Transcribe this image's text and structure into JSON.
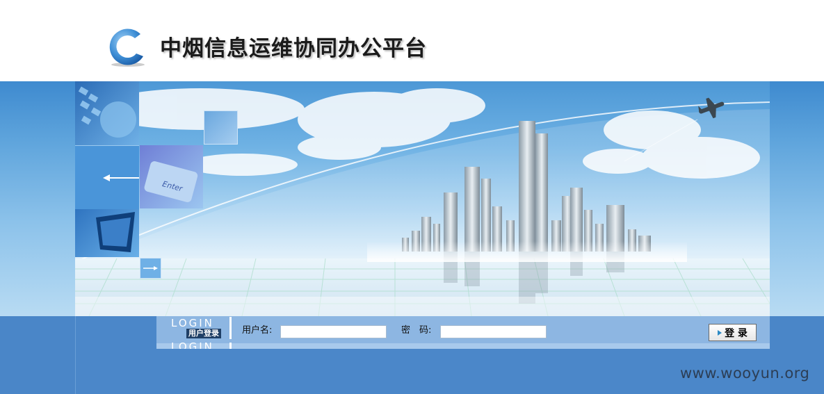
{
  "header": {
    "title": "中烟信息运维协同办公平台"
  },
  "login": {
    "heading": "LOGIN",
    "heading_echo": "LOGIN",
    "subheading": "用户登录",
    "username_label": "用户名:",
    "username_value": "",
    "password_label": "密　码:",
    "password_value": "",
    "submit_label": "登 录"
  },
  "banner": {
    "enter_key_text": "Enter"
  },
  "watermark": "www.wooyun.org",
  "colors": {
    "login_bar": "#4a86c8",
    "login_strip": "#8db6e2",
    "banner_sky_top": "#4d98d6",
    "title_text": "#1b1b1b"
  },
  "icons": [
    "logo-icon",
    "arrow-left-icon",
    "arrow-right-icon",
    "airplane-icon",
    "button-arrow-icon"
  ]
}
